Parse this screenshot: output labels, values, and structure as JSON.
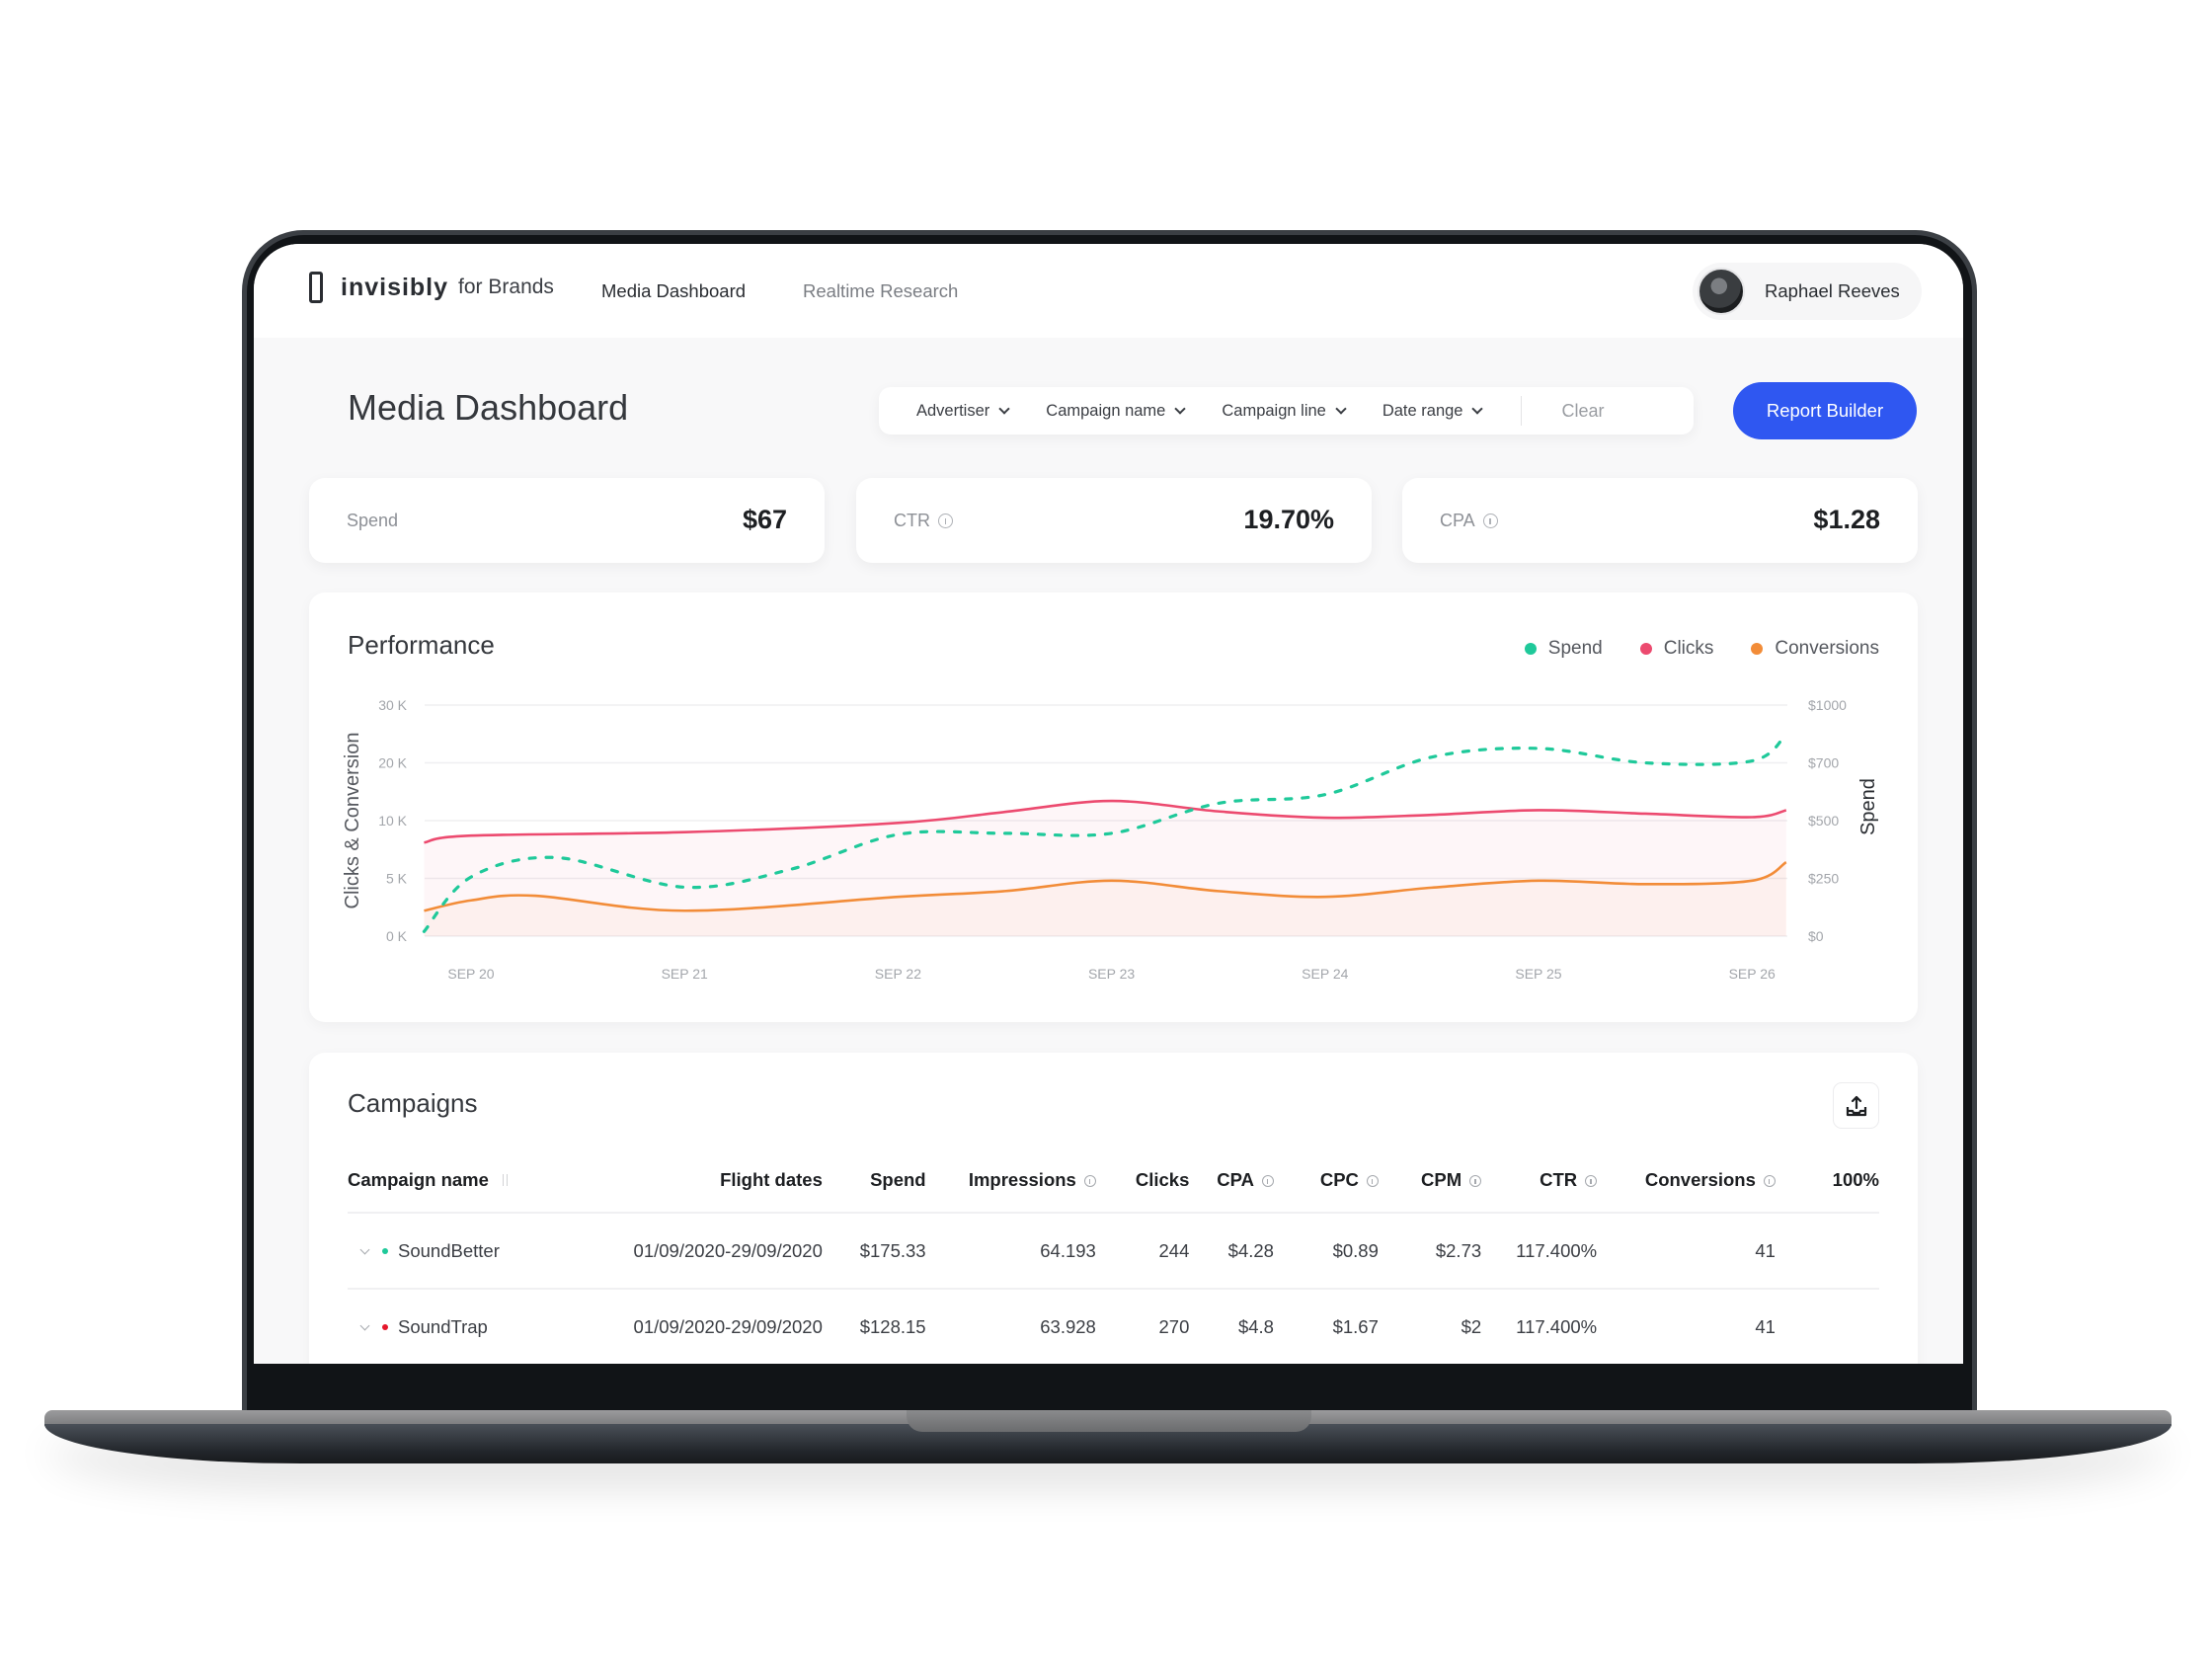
{
  "header": {
    "logo_word": "invisibly",
    "logo_sub": "for Brands",
    "nav": [
      {
        "label": "Media Dashboard",
        "active": true
      },
      {
        "label": "Realtime Research",
        "active": false
      }
    ],
    "user": {
      "name": "Raphael Reeves",
      "avatar_icon": "user-avatar"
    }
  },
  "page": {
    "title": "Media Dashboard",
    "filters": [
      {
        "label": "Advertiser",
        "icon": "chevron-down-icon"
      },
      {
        "label": "Campaign name",
        "icon": "chevron-down-icon"
      },
      {
        "label": "Campaign line",
        "icon": "chevron-down-icon"
      },
      {
        "label": "Date range",
        "icon": "chevron-down-icon"
      }
    ],
    "clear_label": "Clear",
    "report_builder_label": "Report Builder"
  },
  "kpis": [
    {
      "label": "Spend",
      "value": "$67",
      "info": false
    },
    {
      "label": "CTR",
      "value": "19.70%",
      "info": true
    },
    {
      "label": "CPA",
      "value": "$1.28",
      "info": true
    }
  ],
  "performance": {
    "title": "Performance"
  },
  "chart_data": {
    "type": "line",
    "title": "Performance",
    "x": [
      "SEP 20",
      "SEP 21",
      "SEP 22",
      "SEP 23",
      "SEP 24",
      "SEP 25",
      "SEP 26"
    ],
    "ylabel": "Clicks & Conversion",
    "y2label": "Spend",
    "y_ticks": [
      0,
      5000,
      10000,
      20000,
      30000
    ],
    "y_tick_labels": [
      "0 K",
      "5 K",
      "10 K",
      "20 K",
      "30 K"
    ],
    "y2_ticks": [
      0,
      250,
      500,
      700,
      1000
    ],
    "y2_tick_labels": [
      "$0",
      "$250",
      "$500",
      "$700",
      "$1000"
    ],
    "grid": true,
    "legend_position": "top-right",
    "series": [
      {
        "name": "Spend",
        "axis": "right",
        "color": "#1fc99a",
        "style": "dashed",
        "x_pos": [
          -0.22,
          0,
          0.4,
          1,
          1.5,
          2,
          2.5,
          3,
          3.5,
          4,
          4.5,
          5,
          5.5,
          6,
          6.16
        ],
        "values": [
          20,
          256,
          340,
          212,
          290,
          440,
          445,
          445,
          560,
          590,
          730,
          775,
          700,
          710,
          850
        ]
      },
      {
        "name": "Clicks",
        "axis": "left",
        "color": "#ec4a6f",
        "style": "solid",
        "x_pos": [
          -0.22,
          0,
          1,
          2,
          2.5,
          3,
          3.5,
          4,
          4.5,
          5,
          5.5,
          6,
          6.16
        ],
        "values": [
          8100,
          8700,
          9000,
          9800,
          11500,
          13400,
          11600,
          10500,
          11000,
          11800,
          11200,
          10600,
          11800
        ]
      },
      {
        "name": "Conversions",
        "axis": "left",
        "color": "#f28c38",
        "style": "solid",
        "x_pos": [
          -0.22,
          0,
          0.3,
          1,
          2,
          2.5,
          3,
          3.5,
          4,
          4.5,
          5,
          5.5,
          6,
          6.16
        ],
        "values": [
          2200,
          3100,
          3500,
          2200,
          3400,
          3900,
          4800,
          3900,
          3400,
          4200,
          4800,
          4500,
          4800,
          6400
        ]
      }
    ]
  },
  "campaigns": {
    "title": "Campaigns",
    "export_icon": "export-icon",
    "columns": [
      {
        "label": "Campaign name",
        "info": false,
        "align": "left"
      },
      {
        "label": "Flight dates",
        "info": false
      },
      {
        "label": "Spend",
        "info": false
      },
      {
        "label": "Impressions",
        "info": true
      },
      {
        "label": "Clicks",
        "info": false
      },
      {
        "label": "CPA",
        "info": true
      },
      {
        "label": "CPC",
        "info": true
      },
      {
        "label": "CPM",
        "info": true
      },
      {
        "label": "CTR",
        "info": true
      },
      {
        "label": "Conversions",
        "info": true
      },
      {
        "label": "100%",
        "info": false
      }
    ],
    "rows": [
      {
        "name": "SoundBetter",
        "dot_color": "#1fc99a",
        "flight": "01/09/2020-29/09/2020",
        "spend": "$175.33",
        "impressions": "64.193",
        "clicks": "244",
        "cpa": "$4.28",
        "cpc": "$0.89",
        "cpm": "$2.73",
        "ctr": "117.400%",
        "conversions": "41",
        "pct": ""
      },
      {
        "name": "SoundTrap",
        "dot_color": "#e5172b",
        "flight": "01/09/2020-29/09/2020",
        "spend": "$128.15",
        "impressions": "63.928",
        "clicks": "270",
        "cpa": "$4.8",
        "cpc": "$1.67",
        "cpm": "$2",
        "ctr": "117.400%",
        "conversions": "41",
        "pct": ""
      }
    ]
  }
}
